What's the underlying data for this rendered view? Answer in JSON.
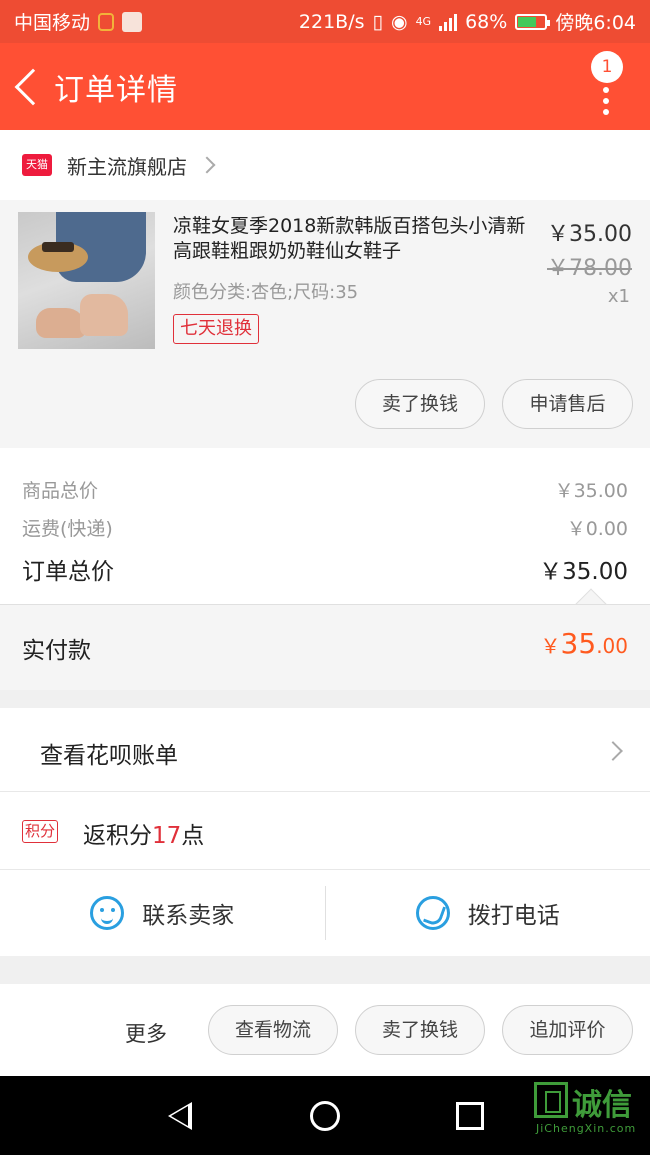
{
  "status_bar": {
    "carrier": "中国移动",
    "speed": "221B/s",
    "network": "4G",
    "battery": "68%",
    "battery_level": 0.68,
    "time": "傍晚6:04"
  },
  "header": {
    "title": "订单详情",
    "badge_count": "1"
  },
  "shop": {
    "tag": "天猫",
    "name": "新主流旗舰店"
  },
  "product": {
    "title": "凉鞋女夏季2018新款韩版百搭包头小清新高跟鞋粗跟奶奶鞋仙女鞋子",
    "spec": "颜色分类:杏色;尺码:35",
    "tag": "七天退换",
    "price": "￥35.00",
    "original_price": "￥78.00",
    "quantity": "x1",
    "buttons": {
      "sell": "卖了换钱",
      "after_sales": "申请售后"
    }
  },
  "summary": {
    "goods_total_label": "商品总价",
    "goods_total": "￥35.00",
    "shipping_label": "运费(快递)",
    "shipping": "￥0.00",
    "order_total_label": "订单总价",
    "order_total": "￥35.00",
    "paid_label": "实付款",
    "paid_currency": "￥",
    "paid_int": "35",
    "paid_dec": ".00"
  },
  "huabei": {
    "label": "查看花呗账单"
  },
  "points": {
    "tag": "积分",
    "prefix": "返积分",
    "value": "17",
    "suffix": "点"
  },
  "contact": {
    "seller": "联系卖家",
    "call": "拨打电话"
  },
  "actions": {
    "more": "更多",
    "logistics": "查看物流",
    "sell": "卖了换钱",
    "review": "追加评价"
  },
  "watermark": {
    "text": "诚信",
    "url": "JiChengXin.com"
  },
  "colors": {
    "header": "#ff5034",
    "accent_red": "#e0303a",
    "paid_orange": "#ff5a1f",
    "icon_blue": "#2a9fe0"
  }
}
